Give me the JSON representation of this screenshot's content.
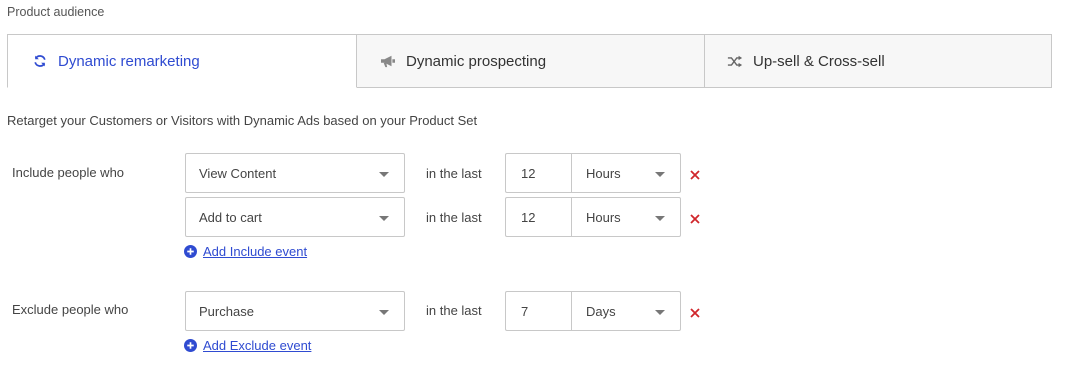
{
  "section_title": "Product audience",
  "tabs": [
    {
      "label": "Dynamic remarketing",
      "icon": "refresh-icon",
      "active": true
    },
    {
      "label": "Dynamic prospecting",
      "icon": "megaphone-icon",
      "active": false
    },
    {
      "label": "Up-sell & Cross-sell",
      "icon": "shuffle-icon",
      "active": false
    }
  ],
  "description": "Retarget your Customers or Visitors with Dynamic Ads based on your Product Set",
  "include": {
    "label": "Include people who",
    "rows": [
      {
        "event": "View Content",
        "in_last": "in the last",
        "number": "12",
        "unit": "Hours"
      },
      {
        "event": "Add to cart",
        "in_last": "in the last",
        "number": "12",
        "unit": "Hours"
      }
    ],
    "add_link": "Add Include event"
  },
  "exclude": {
    "label": "Exclude people who",
    "rows": [
      {
        "event": "Purchase",
        "in_last": "in the last",
        "number": "7",
        "unit": "Days"
      }
    ],
    "add_link": "Add Exclude event"
  },
  "colors": {
    "accent": "#2f4bd1",
    "remove": "#d0262b",
    "border": "#c8c8c8"
  }
}
